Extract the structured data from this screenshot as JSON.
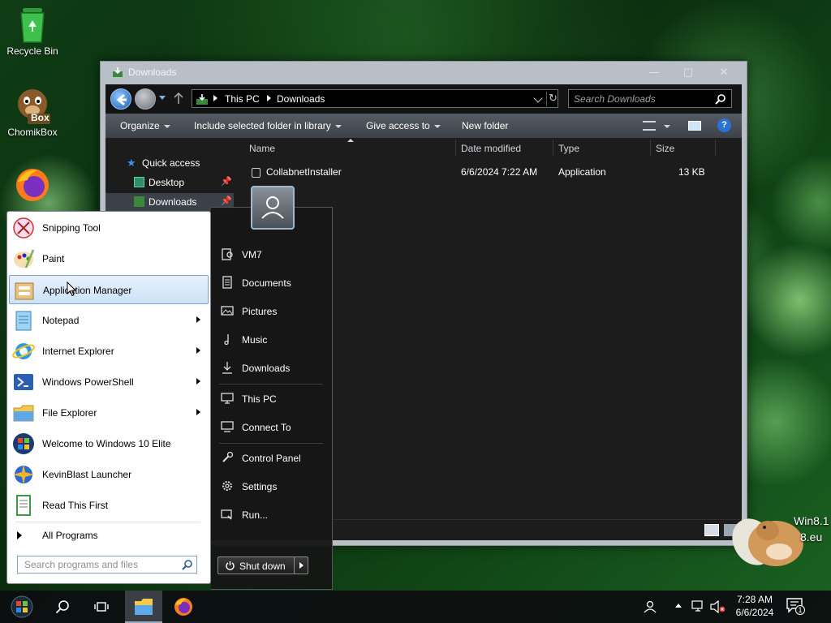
{
  "desktop": {
    "icons": [
      {
        "label": "Recycle Bin",
        "icon": "recycle-bin-icon"
      },
      {
        "label": "ChomikBox",
        "icon": "chomikbox-icon",
        "badge": "Box"
      },
      {
        "label": "",
        "icon": "firefox-icon"
      }
    ],
    "watermark": [
      "Win8.1",
      "8.eu"
    ]
  },
  "explorer": {
    "title": "Downloads",
    "breadcrumb": [
      "This PC",
      "Downloads"
    ],
    "search_placeholder": "Search Downloads",
    "toolbar": {
      "organize": "Organize",
      "include": "Include selected folder in library",
      "give_access": "Give access to",
      "new_folder": "New folder"
    },
    "nav": [
      {
        "label": "Quick access"
      },
      {
        "label": "Desktop"
      },
      {
        "label": "Downloads"
      }
    ],
    "columns": [
      "Name",
      "Date modified",
      "Type",
      "Size"
    ],
    "files": [
      {
        "name": "CollabnetInstaller",
        "date": "6/6/2024 7:22 AM",
        "type": "Application",
        "size": "13 KB"
      }
    ]
  },
  "start_menu": {
    "programs": [
      {
        "label": "Snipping Tool",
        "icon": "snipping-tool-icon",
        "submenu": false
      },
      {
        "label": "Paint",
        "icon": "paint-icon",
        "submenu": false
      },
      {
        "label": "Application Manager",
        "icon": "application-manager-icon",
        "submenu": false,
        "selected": true
      },
      {
        "label": "Notepad",
        "icon": "notepad-icon",
        "submenu": true
      },
      {
        "label": "Internet Explorer",
        "icon": "internet-explorer-icon",
        "submenu": true
      },
      {
        "label": "Windows PowerShell",
        "icon": "powershell-icon",
        "submenu": true
      },
      {
        "label": "File Explorer",
        "icon": "file-explorer-icon",
        "submenu": true
      },
      {
        "label": "Welcome to Windows 10 Elite",
        "icon": "windows-orb-icon",
        "submenu": false
      },
      {
        "label": "KevinBlast Launcher",
        "icon": "kevinblast-icon",
        "submenu": false
      },
      {
        "label": "Read This First",
        "icon": "read-this-first-icon",
        "submenu": false
      }
    ],
    "all_programs": "All Programs",
    "search_placeholder": "Search programs and files",
    "right": [
      {
        "label": "VM7",
        "icon": "user-folder-icon"
      },
      {
        "label": "Documents",
        "icon": "documents-icon"
      },
      {
        "label": "Pictures",
        "icon": "pictures-icon"
      },
      {
        "label": "Music",
        "icon": "music-icon"
      },
      {
        "label": "Downloads",
        "icon": "downloads-icon"
      },
      {
        "label": "This PC",
        "icon": "this-pc-icon"
      },
      {
        "label": "Connect To",
        "icon": "connect-to-icon"
      },
      {
        "label": "Control Panel",
        "icon": "control-panel-icon"
      },
      {
        "label": "Settings",
        "icon": "settings-icon"
      },
      {
        "label": "Run...",
        "icon": "run-icon"
      }
    ],
    "shutdown": "Shut down"
  },
  "taskbar": {
    "time": "7:28 AM",
    "date": "6/6/2024",
    "notification_count": "1"
  },
  "colors": {
    "accent_selection": "#cde2f7",
    "explorer_dark": "#1c1c1c",
    "taskbar": "#0c0e10"
  }
}
